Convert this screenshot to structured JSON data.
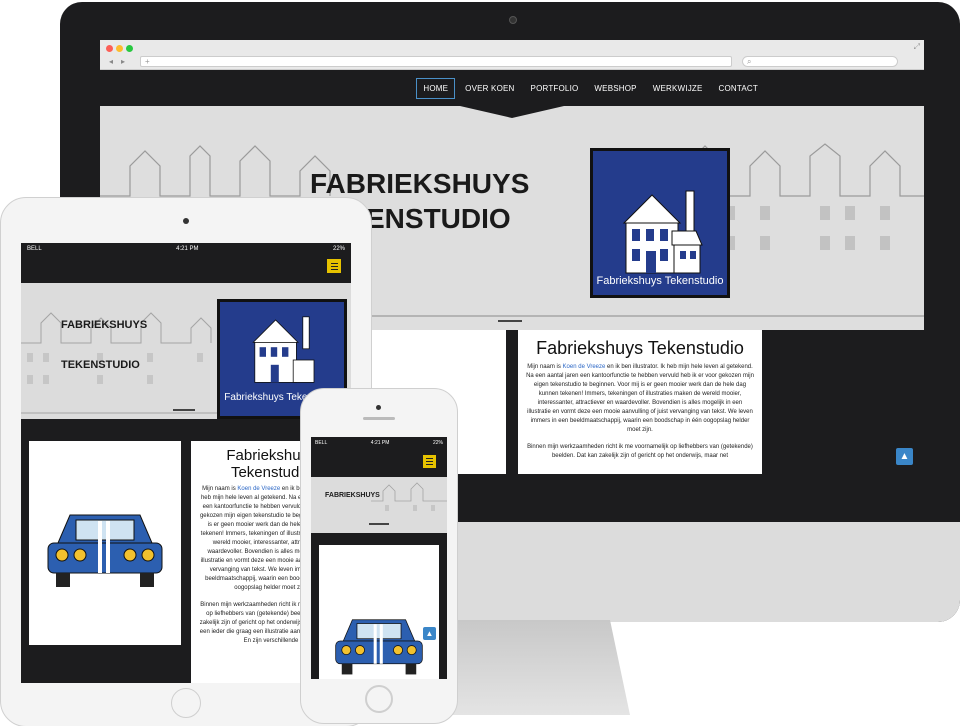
{
  "browser": {
    "url": "",
    "search_placeholder": ""
  },
  "site": {
    "nav": [
      {
        "label": "HOME",
        "active": true
      },
      {
        "label": "OVER KOEN",
        "active": false
      },
      {
        "label": "PORTFOLIO",
        "active": false
      },
      {
        "label": "WEBSHOP",
        "active": false
      },
      {
        "label": "WERKWIJZE",
        "active": false
      },
      {
        "label": "CONTACT",
        "active": false
      }
    ],
    "hero_line1": "FABRIEKSHUYS",
    "hero_line2": "TEKENSTUDIO",
    "logo_caption": "Fabriekshuys Tekenstudio",
    "card_title": "Fabriekshuys Tekenstudio",
    "text_before_link": "Mijn naam is ",
    "link_text": "Koen de Vreeze",
    "text_after_link": " en ik ben illustrator. Ik heb mijn hele leven al getekend. Na een aantal jaren een kantoorfunctie te hebben vervuld heb ik er voor gekozen mijn eigen tekenstudio te beginnen. Voor mij is er geen mooier werk dan de hele dag kunnen tekenen! Immers, tekeningen of illustraties maken de wereld mooier, interessanter, attractiever en waardevoller. Bovendien is alles mogelijk in een illustratie en vormt deze een mooie aanvulling of juist vervanging van tekst. We leven immers in een beeldmaatschappij, waarin een boodschap in één oogopslag helder moet zijn.",
    "text_paragraph2": "Binnen mijn werkzaamheden richt ik me voornamelijk op liefhebbers van (getekende) beelden. Dat kan zakelijk zijn of gericht op het onderwijs, maar net",
    "scroll_top_icon": "▲"
  },
  "ipad": {
    "carrier": "BELL",
    "time": "4:21 PM",
    "battery": "22%",
    "card_title_line1": "Fabriekshuys",
    "card_title_line2": "Tekenstudio",
    "text_before_link": "Mijn naam is ",
    "link_text": "Koen de Vreeze",
    "text_after_link": " en ik ben illustrator. Ik heb mijn hele leven al getekend. Na een aantal jaren een kantoorfunctie te hebben vervuld heb ik er voor gekozen mijn eigen tekenstudio te beginnen. Voor mij is er geen mooier werk dan de hele dag kunnen tekenen! Immers, tekeningen of illustraties maken de wereld mooier, interessanter, attractiever en waardevoller. Bovendien is alles mogelijk in een illustratie en vormt deze een mooie aanvulling of juist vervanging van tekst. We leven immers in een beeldmaatschappij, waarin een boodschap in één oogopslag helder moet zijn.",
    "text_paragraph2": "Binnen mijn werkzaamheden richt ik me voornamelijk op liefhebbers van (getekende) beelden. Dat kan zakelijk zijn of gericht op het onderwijs, maar net voor een ieder die graag een illustratie aan de muur hangt. En zijn verschillende"
  },
  "iphone": {
    "carrier": "BELL",
    "time": "4:21 PM",
    "battery": "22%",
    "hero_title": "FABRIEKSHUYS"
  },
  "colors": {
    "accent_blue": "#3a86c8",
    "logo_blue": "#243c8c",
    "menu_yellow": "#e6c200",
    "dark_bg": "#1c1c1e"
  }
}
